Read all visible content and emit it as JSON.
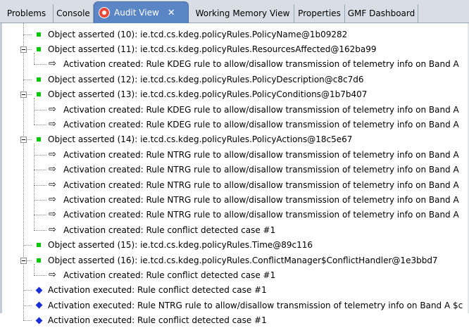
{
  "tabs": [
    {
      "label": "Problems",
      "active": false
    },
    {
      "label": "Console",
      "active": false
    },
    {
      "label": "Audit View",
      "active": true
    },
    {
      "label": "Working Memory View",
      "active": false
    },
    {
      "label": "Properties",
      "active": false
    },
    {
      "label": "GMF Dashboard",
      "active": false
    }
  ],
  "close_glyph": "✕",
  "arrow_glyph": "⇨",
  "icons": {
    "asserted": "green-square-icon",
    "activation": "arrow-icon",
    "executed": "blue-diamond-icon"
  },
  "colors": {
    "active_tab": "#5a86c6",
    "asserted": "#00c800",
    "executed": "#1a2ed6"
  },
  "log": [
    {
      "type": "asserted",
      "text": "Object asserted (10): ie.tcd.cs.kdeg.policyRules.PolicyName@1b09282",
      "level": 0,
      "expanded": false
    },
    {
      "type": "asserted",
      "text": "Object asserted (11): ie.tcd.cs.kdeg.policyRules.ResourcesAffected@162ba99",
      "level": 0,
      "expanded": true
    },
    {
      "type": "activation",
      "text": "Activation created: Rule KDEG rule to allow/disallow transmission of telemetry info on Band A",
      "level": 1
    },
    {
      "type": "asserted",
      "text": "Object asserted (12): ie.tcd.cs.kdeg.policyRules.PolicyDescription@c8c7d6",
      "level": 0,
      "expanded": false
    },
    {
      "type": "asserted",
      "text": "Object asserted (13): ie.tcd.cs.kdeg.policyRules.PolicyConditions@1b7b407",
      "level": 0,
      "expanded": true
    },
    {
      "type": "activation",
      "text": "Activation created: Rule KDEG rule to allow/disallow transmission of telemetry info on Band A",
      "level": 1
    },
    {
      "type": "activation",
      "text": "Activation created: Rule KDEG rule to allow/disallow transmission of telemetry info on Band A",
      "level": 1
    },
    {
      "type": "asserted",
      "text": "Object asserted (14): ie.tcd.cs.kdeg.policyRules.PolicyActions@18c5e67",
      "level": 0,
      "expanded": true
    },
    {
      "type": "activation",
      "text": "Activation created: Rule NTRG rule to allow/disallow transmission of telemetry info on Band A",
      "level": 1
    },
    {
      "type": "activation",
      "text": "Activation created: Rule NTRG rule to allow/disallow transmission of telemetry info on Band A",
      "level": 1
    },
    {
      "type": "activation",
      "text": "Activation created: Rule NTRG rule to allow/disallow transmission of telemetry info on Band A",
      "level": 1
    },
    {
      "type": "activation",
      "text": "Activation created: Rule NTRG rule to allow/disallow transmission of telemetry info on Band A",
      "level": 1
    },
    {
      "type": "activation",
      "text": "Activation created: Rule NTRG rule to allow/disallow transmission of telemetry info on Band A",
      "level": 1
    },
    {
      "type": "activation",
      "text": "Activation created: Rule conflict detected case #1",
      "level": 1
    },
    {
      "type": "asserted",
      "text": "Object asserted (15): ie.tcd.cs.kdeg.policyRules.Time@89c116",
      "level": 0,
      "expanded": false
    },
    {
      "type": "asserted",
      "text": "Object asserted (16): ie.tcd.cs.kdeg.policyRules.ConflictManager$ConflictHandler@1e3bbd7",
      "level": 0,
      "expanded": true
    },
    {
      "type": "activation",
      "text": "Activation created: Rule conflict detected case #1",
      "level": 1
    },
    {
      "type": "executed",
      "text": "Activation executed: Rule conflict detected case #1",
      "level": 0
    },
    {
      "type": "executed",
      "text": "Activation executed: Rule NTRG rule to allow/disallow transmission of telemetry info on Band A $c",
      "level": 0
    },
    {
      "type": "executed",
      "text": "Activation executed: Rule conflict detected case #1",
      "level": 0
    }
  ]
}
